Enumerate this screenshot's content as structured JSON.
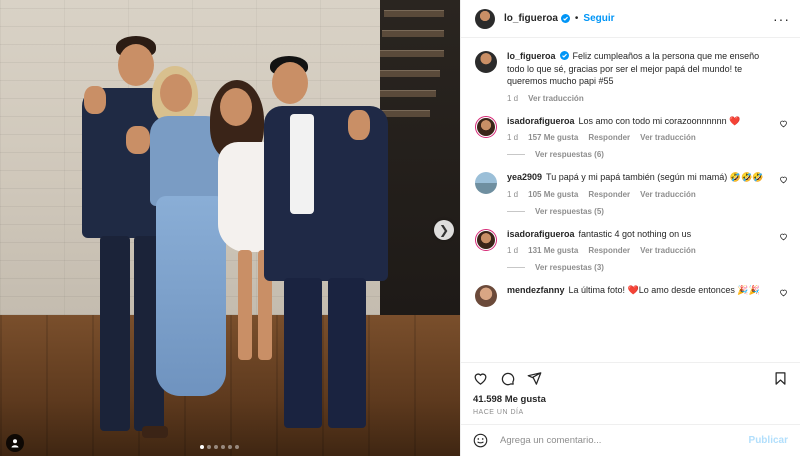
{
  "colors": {
    "accent": "#0095f6",
    "heart": "#ed4956",
    "muted": "#8e8e8e",
    "text": "#262626"
  },
  "media": {
    "carousel_count": 6,
    "carousel_active": 1,
    "next_icon": "chevron-right-icon",
    "tag_icon": "user-tag-icon"
  },
  "header": {
    "username": "lo_figueroa",
    "separator": "•",
    "follow_label": "Seguir",
    "more_label": "···"
  },
  "caption": {
    "username": "lo_figueroa",
    "text": "Feliz cumpleaños a la persona que me enseño todo lo que sé, gracias por ser el mejor papá del mundo! te queremos mucho papi #55",
    "age": "1 d",
    "translate": "Ver traducción"
  },
  "comments": [
    {
      "username": "isadorafigueroa",
      "text": "Los amo con todo mi corazoonnnnnn ❤️",
      "age": "1 d",
      "likes": "157 Me gusta",
      "reply": "Responder",
      "translate": "Ver traducción",
      "replies": "Ver respuestas (6)"
    },
    {
      "username": "yea2909",
      "text": "Tu papá y mi papá también (según mi mamá) 🤣🤣🤣",
      "age": "1 d",
      "likes": "105 Me gusta",
      "reply": "Responder",
      "translate": "Ver traducción",
      "replies": "Ver respuestas (5)"
    },
    {
      "username": "isadorafigueroa",
      "text": "fantastic 4 got nothing on us",
      "age": "1 d",
      "likes": "131 Me gusta",
      "reply": "Responder",
      "translate": "Ver traducción",
      "replies": "Ver respuestas (3)"
    },
    {
      "username": "mendezfanny",
      "text": "La última foto! ❤️Lo amo desde entonces 🎉🎉"
    }
  ],
  "actions": {
    "like_icon": "heart-icon",
    "comment_icon": "comment-icon",
    "share_icon": "share-icon",
    "save_icon": "bookmark-icon"
  },
  "likes_count": "41.598 Me gusta",
  "posted": "HACE UN DÍA",
  "composer": {
    "placeholder": "Agrega un comentario...",
    "publish_label": "Publicar",
    "emoji_icon": "emoji-icon"
  }
}
